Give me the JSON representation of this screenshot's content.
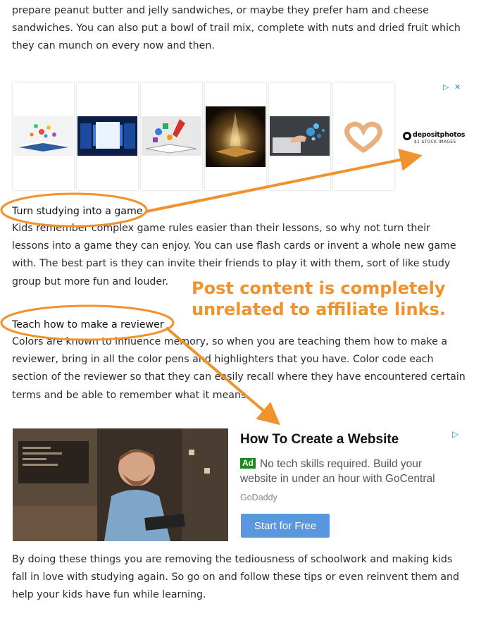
{
  "intro_paragraph": "prepare peanut butter and jelly sandwiches, or maybe they prefer ham and cheese sandwiches. You can also put a bowl of trail mix, complete with nuts and dried fruit which they can munch on every now and then.",
  "image_ad": {
    "thumbnail_icons": [
      "books-cloud-icon",
      "screens-icon",
      "book-rocket-icon",
      "glowing-book-icon",
      "hand-splash-icon",
      "heart-hands-icon"
    ],
    "brand_name": "depositphotos",
    "brand_tagline": "$1 STOCK IMAGES",
    "adchoices_glyph": "▷",
    "close_glyph": "✕"
  },
  "section_1": {
    "heading": "Turn studying into a game",
    "body": "Kids remember complex game rules easier than their lessons, so why not turn their lessons into a game they can enjoy. You can use flash cards or invent a whole new game with. The best part is they can invite their friends to play it with them, sort of like study group but more fun and louder."
  },
  "annotation": {
    "text": "Post content is completely unrelated to affiliate links.",
    "color": "#f0922d"
  },
  "section_2": {
    "heading": "Teach how to make a reviewer",
    "body": "Colors are known to influence memory, so when you are teaching them how to make a reviewer, bring in all the color pens and highlighters that you have. Color code each section of the reviewer so that they can easily recall where they have encountered certain terms and be able to remember what it means."
  },
  "text_ad": {
    "title": "How To Create a Website",
    "badge": "Ad",
    "description": "No tech skills required. Build your website in under an hour with GoCentral",
    "brand": "GoDaddy",
    "cta_label": "Start for Free",
    "adchoices_glyph": "▷"
  },
  "closing_paragraph": "By doing these things you are removing the tediousness of schoolwork and making kids fall in love with studying again. So go on and follow these tips or even reinvent them and help your kids have fun while learning."
}
